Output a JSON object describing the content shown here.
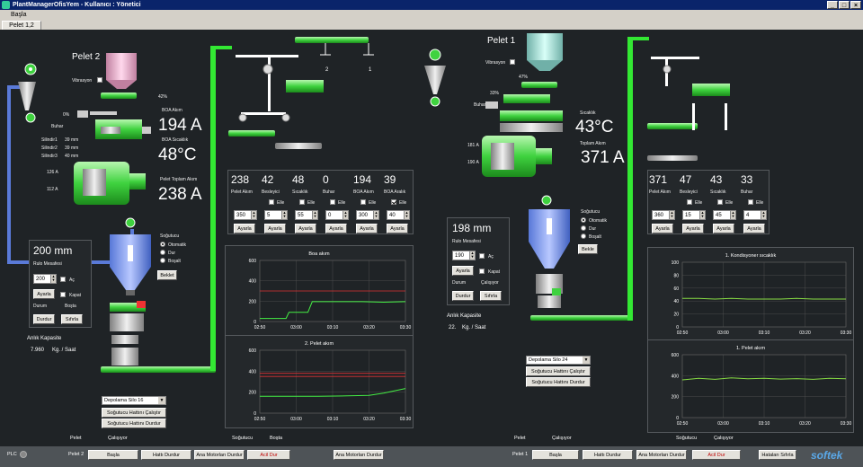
{
  "window": {
    "title": "PlantManagerOfisYem - Kullanıcı : Yönetici",
    "menu": "Başla",
    "tab": "Pelet 1,2"
  },
  "left": {
    "title": "Pelet 2",
    "vibrasyon": "Vibrasyon",
    "feed_pct": "42%",
    "steam_pct": "0%",
    "buhar": "Buhar",
    "boa_akim_label": "BOA Akım",
    "boa_akim": "194 A",
    "boa_sicaklik_label": "BOA Sıcaklık",
    "boa_sicaklik": "48°C",
    "toplam_label": "Pelet Toplam Akım",
    "toplam": "238 A",
    "silindir": [
      {
        "label": "Silindir1",
        "value": "39 mm"
      },
      {
        "label": "Silindir2",
        "value": "39 mm"
      },
      {
        "label": "Silindir3",
        "value": "40 mm"
      }
    ],
    "motor_a1": "126 A",
    "motor_a2": "112 A",
    "cooler": {
      "label": "Soğutucu",
      "options": [
        "Otomatik",
        "Dur",
        "Boşalt"
      ],
      "selected": 0,
      "button": "Beklet"
    },
    "roll": {
      "value": "200 mm",
      "label": "Rulo Mesafesi",
      "input": "200",
      "ac": "Aç",
      "ayarla": "Ayarla",
      "kapat": "Kapat",
      "durum": "Durum",
      "bosta": "Boşta",
      "durdur": "Durdur",
      "sifirla": "Sıfırla"
    },
    "capacity_label": "Anlık Kapasite",
    "capacity_value": "7.960",
    "capacity_unit": "Kg. / Saat",
    "silo": "Depolama Silo 16",
    "cool_start": "Soğutucu Hattını Çalıştır",
    "cool_stop": "Soğutucu Hattını Durdur",
    "params": [
      {
        "value": "238",
        "label": "Pelet Akım",
        "input": "350",
        "chk": false,
        "elle": ""
      },
      {
        "value": "42",
        "label": "Besleyici",
        "input": "5",
        "chk": false,
        "elle": "Elle"
      },
      {
        "value": "48",
        "label": "Sıcaklık",
        "input": "55",
        "chk": false,
        "elle": "Elle"
      },
      {
        "value": "0",
        "label": "Buhar",
        "input": "0",
        "chk": false,
        "elle": "Elle"
      },
      {
        "value": "194",
        "label": "BOA Akım",
        "input": "300",
        "chk": false,
        "elle": "Elle"
      },
      {
        "value": "39",
        "label": "BOA Aralık",
        "input": "40",
        "chk": true,
        "elle": "Elle"
      }
    ],
    "ayarla": "Ayarla",
    "divert_1": "1",
    "divert_2": "2"
  },
  "right": {
    "title": "Pelet 1",
    "vibrasyon": "Vibrasyon",
    "feed_pct": "47%",
    "steam_pct": "33%",
    "buhar": "Buhar",
    "sicaklik_label": "Sıcaklık",
    "sicaklik": "43°C",
    "toplam_label": "Toplam Akım",
    "toplam": "371 A",
    "motor_a1": "181 A",
    "motor_a2": "190 A",
    "cooler": {
      "label": "Soğutucu",
      "options": [
        "Otomatik",
        "Dur",
        "Boşalt"
      ],
      "selected": 0,
      "button": "Bekle"
    },
    "roll": {
      "value": "198 mm",
      "label": "Rulo Mesafesi",
      "input": "190",
      "ac": "Aç",
      "ayarla": "Ayarla",
      "kapat": "Kapat",
      "durum": "Durum",
      "calisiyor": "Çalışıyor",
      "durdur": "Durdur",
      "sifirla": "Sıfırla"
    },
    "capacity_label": "Anlık Kapasite",
    "capacity_value": "22.",
    "capacity_unit": "Kg. / Saat",
    "silo": "Depolama Silo 24",
    "cool_start": "Soğutucu Hattını Çalıştır",
    "cool_stop": "Soğutucu Hattını Durdur",
    "params": [
      {
        "value": "371",
        "label": "Pelet Akım",
        "input": "360",
        "chk": false,
        "elle": ""
      },
      {
        "value": "47",
        "label": "Besleyici",
        "input": "15",
        "chk": false,
        "elle": "Elle"
      },
      {
        "value": "43",
        "label": "Sıcaklık",
        "input": "45",
        "chk": false,
        "elle": "Elle"
      },
      {
        "value": "33",
        "label": "Buhar",
        "input": "4",
        "chk": false,
        "elle": "Elle"
      }
    ],
    "ayarla": "Ayarla"
  },
  "chart_data": [
    {
      "type": "line",
      "title": "Boa akım",
      "categories": [
        "02:50",
        "03:00",
        "03:10",
        "03:20",
        "03:30"
      ],
      "ylim": [
        0,
        600
      ],
      "yticks": [
        0,
        200,
        400,
        600
      ],
      "limit": 300,
      "x": [
        0,
        0.08,
        0.14,
        0.18,
        0.2,
        0.26,
        0.3,
        0.33,
        0.36,
        0.5,
        0.7,
        0.85,
        1
      ],
      "values": [
        30,
        30,
        30,
        30,
        90,
        90,
        90,
        90,
        195,
        195,
        195,
        190,
        195
      ],
      "color": "#44ee44",
      "limit_color": "#dd3333"
    },
    {
      "type": "line",
      "title": "2. Pelet akım",
      "categories": [
        "02:50",
        "03:00",
        "03:10",
        "03:20",
        "03:30"
      ],
      "ylim": [
        0,
        600
      ],
      "yticks": [
        0,
        200,
        400,
        600
      ],
      "limit": 350,
      "limit2": 380,
      "x": [
        0,
        0.2,
        0.4,
        0.6,
        0.75,
        0.85,
        1
      ],
      "values": [
        160,
        160,
        160,
        165,
        170,
        190,
        235
      ],
      "color": "#44ee44",
      "limit_color": "#dd3333"
    },
    {
      "type": "line",
      "title": "1. Kondisyoner sıcaklık",
      "categories": [
        "02:50",
        "03:00",
        "03:10",
        "03:20",
        "03:30"
      ],
      "ylim": [
        0,
        100
      ],
      "yticks": [
        0,
        20,
        40,
        60,
        80,
        100
      ],
      "x": [
        0,
        0.1,
        0.2,
        0.3,
        0.4,
        0.5,
        0.6,
        0.7,
        0.8,
        0.9,
        1
      ],
      "values": [
        44,
        44,
        43,
        44,
        43,
        43,
        43,
        44,
        43,
        43,
        43
      ],
      "color": "#88dd44"
    },
    {
      "type": "line",
      "title": "1. Pelet akım",
      "categories": [
        "02:50",
        "03:00",
        "03:10",
        "03:20",
        "03:30"
      ],
      "ylim": [
        0,
        600
      ],
      "yticks": [
        0,
        200,
        400,
        600
      ],
      "x": [
        0,
        0.1,
        0.2,
        0.3,
        0.4,
        0.5,
        0.6,
        0.7,
        0.8,
        0.9,
        1
      ],
      "values": [
        360,
        375,
        365,
        380,
        370,
        375,
        368,
        372,
        365,
        375,
        370
      ],
      "color": "#88dd44"
    }
  ],
  "statusline": {
    "l_pelet": "Pelet",
    "l_calisiyor": "Çalışıyor",
    "l_sogutucu": "Soğutucu",
    "l_bosta": "Boşta",
    "r_pelet": "Pelet",
    "r_calisiyor": "Çalışıyor",
    "r_sogutucu": "Soğutucu",
    "r_calisiyor2": "Çalışıyor"
  },
  "bottom": {
    "plc": "PLC",
    "pelet2": "Pelet 2",
    "basla": "Başla",
    "hatti_durdur": "Hattı Durdur",
    "ana_motorlari_durdur": "Ana Motorları Durdur",
    "acil_dur": "Acil Dur",
    "pelet1": "Pelet 1",
    "hatalari_sifirla": "Hataları Sıfırla",
    "brand": "softek"
  }
}
